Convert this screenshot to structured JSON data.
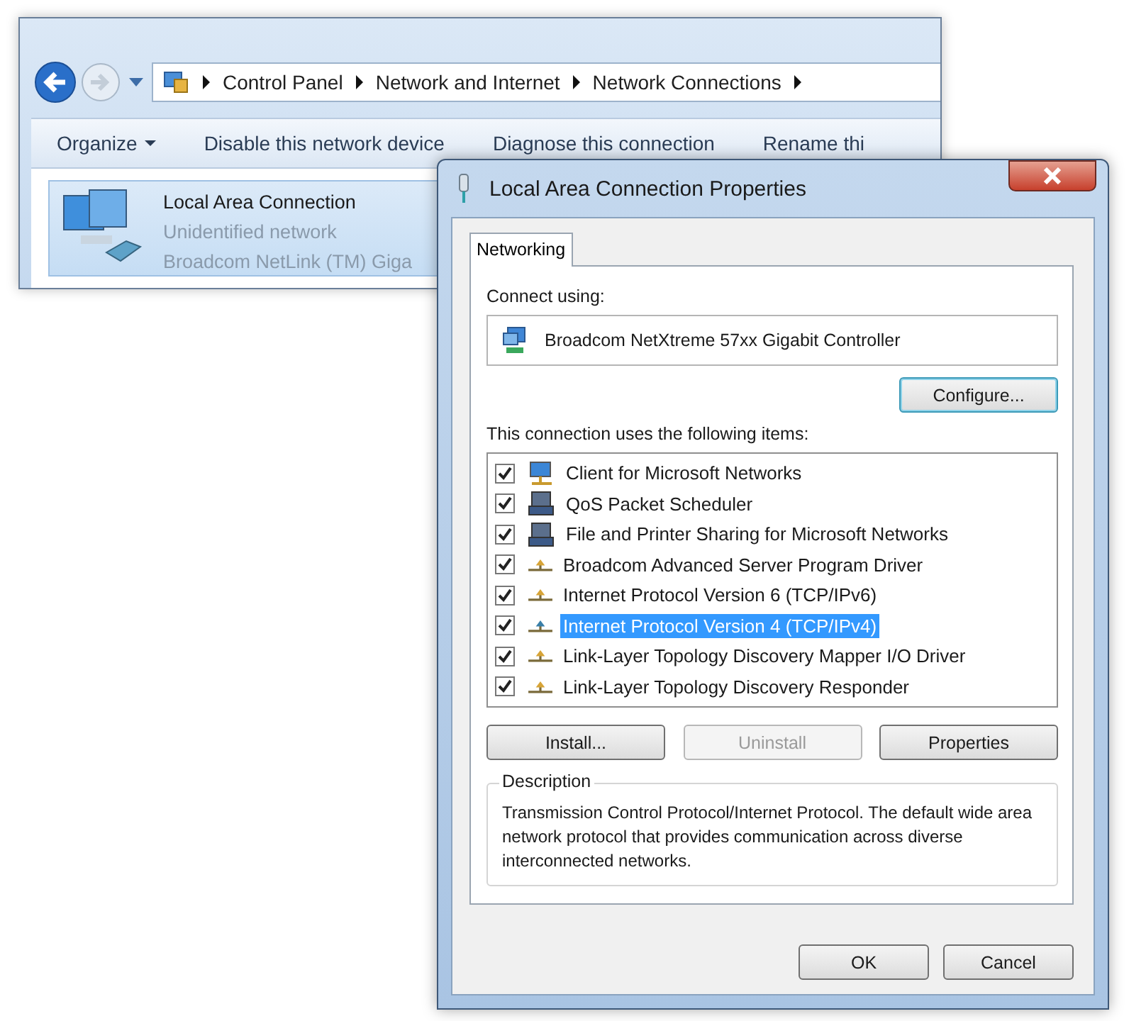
{
  "explorer": {
    "breadcrumb": [
      "Control Panel",
      "Network and Internet",
      "Network Connections"
    ],
    "toolbar": [
      {
        "label": "Organize",
        "dropdown": true
      },
      {
        "label": "Disable this network device",
        "dropdown": false
      },
      {
        "label": "Diagnose this connection",
        "dropdown": false
      },
      {
        "label": "Rename thi",
        "dropdown": false
      }
    ],
    "connection": {
      "name": "Local Area Connection",
      "status": "Unidentified network",
      "device": "Broadcom NetLink (TM) Giga"
    }
  },
  "dialog": {
    "title": "Local Area Connection Properties",
    "tabs": [
      {
        "label": "Networking",
        "selected": true
      }
    ],
    "connect_using_label": "Connect using:",
    "adapter": "Broadcom NetXtreme 57xx Gigabit Controller",
    "configure_button": "Configure...",
    "items_label": "This connection uses the following items:",
    "items": [
      {
        "kind": "client",
        "label": "Client for Microsoft Networks",
        "checked": true,
        "selected": false
      },
      {
        "kind": "service",
        "label": "QoS Packet Scheduler",
        "checked": true,
        "selected": false
      },
      {
        "kind": "service",
        "label": "File and Printer Sharing for Microsoft Networks",
        "checked": true,
        "selected": false
      },
      {
        "kind": "protocol",
        "label": "Broadcom Advanced Server Program Driver",
        "checked": true,
        "selected": false
      },
      {
        "kind": "protocol",
        "label": "Internet Protocol Version 6 (TCP/IPv6)",
        "checked": true,
        "selected": false
      },
      {
        "kind": "protocol",
        "label": "Internet Protocol Version 4 (TCP/IPv4)",
        "checked": true,
        "selected": true
      },
      {
        "kind": "protocol",
        "label": "Link-Layer Topology Discovery Mapper I/O Driver",
        "checked": true,
        "selected": false
      },
      {
        "kind": "protocol",
        "label": "Link-Layer Topology Discovery Responder",
        "checked": true,
        "selected": false
      }
    ],
    "item_buttons": [
      {
        "label": "Install...",
        "disabled": false
      },
      {
        "label": "Uninstall",
        "disabled": true
      },
      {
        "label": "Properties",
        "disabled": false
      }
    ],
    "description_label": "Description",
    "description": "Transmission Control Protocol/Internet Protocol. The default wide area network protocol that provides communication across diverse interconnected networks.",
    "buttons": [
      "OK",
      "Cancel"
    ]
  }
}
